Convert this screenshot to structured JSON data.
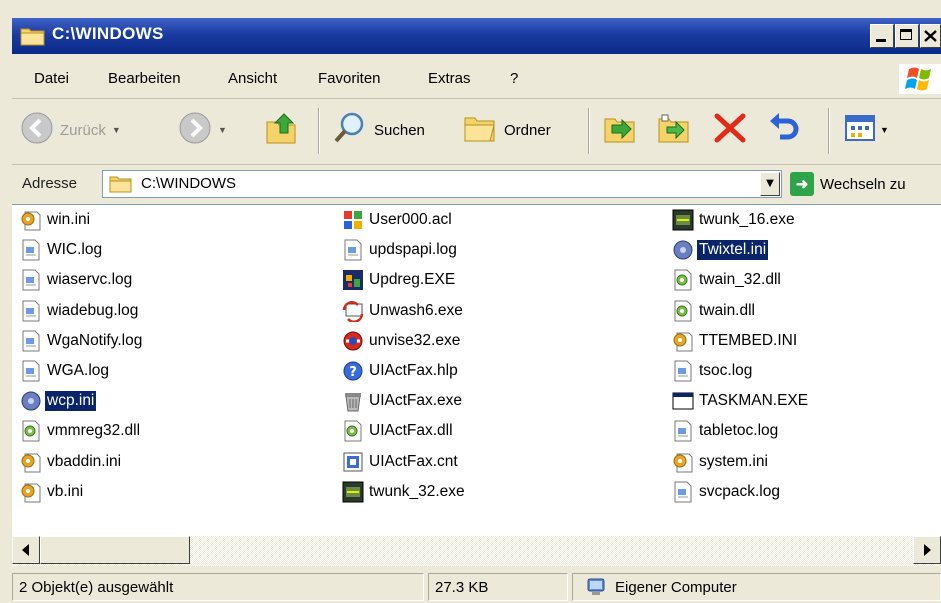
{
  "window": {
    "title": "C:\\WINDOWS"
  },
  "menu": [
    "Datei",
    "Bearbeiten",
    "Ansicht",
    "Favoriten",
    "Extras",
    "?"
  ],
  "toolbar": {
    "back_label": "Zurück",
    "search_label": "Suchen",
    "folders_label": "Ordner"
  },
  "address": {
    "label": "Adresse",
    "value": "C:\\WINDOWS",
    "go_label": "Wechseln zu"
  },
  "files": {
    "column1": [
      {
        "name": "win.ini",
        "icon": "config-file-icon",
        "selected": false
      },
      {
        "name": "WIC.log",
        "icon": "text-file-icon",
        "selected": false
      },
      {
        "name": "wiaservc.log",
        "icon": "text-file-icon",
        "selected": false
      },
      {
        "name": "wiadebug.log",
        "icon": "text-file-icon",
        "selected": false
      },
      {
        "name": "WgaNotify.log",
        "icon": "text-file-icon",
        "selected": false
      },
      {
        "name": "WGA.log",
        "icon": "text-file-icon",
        "selected": false
      },
      {
        "name": "wcp.ini",
        "icon": "unknown-config-icon",
        "selected": true
      },
      {
        "name": "vmmreg32.dll",
        "icon": "dll-file-icon",
        "selected": false
      },
      {
        "name": "vbaddin.ini",
        "icon": "config-file-icon",
        "selected": false
      },
      {
        "name": "vb.ini",
        "icon": "config-file-icon",
        "selected": false
      }
    ],
    "column2": [
      {
        "name": "User000.acl",
        "icon": "acl-file-icon",
        "selected": false
      },
      {
        "name": "updspapi.log",
        "icon": "text-file-icon",
        "selected": false
      },
      {
        "name": "Updreg.EXE",
        "icon": "update-exe-icon",
        "selected": false
      },
      {
        "name": "Unwash6.exe",
        "icon": "uninstall-exe-icon",
        "selected": false
      },
      {
        "name": "unvise32.exe",
        "icon": "unvise-exe-icon",
        "selected": false
      },
      {
        "name": "UIActFax.hlp",
        "icon": "help-file-icon",
        "selected": false
      },
      {
        "name": "UIActFax.exe",
        "icon": "fax-exe-icon",
        "selected": false
      },
      {
        "name": "UIActFax.dll",
        "icon": "dll-file-icon",
        "selected": false
      },
      {
        "name": "UIActFax.cnt",
        "icon": "help-contents-icon",
        "selected": false
      },
      {
        "name": "twunk_32.exe",
        "icon": "scanner-exe-icon",
        "selected": false
      }
    ],
    "column3": [
      {
        "name": "twunk_16.exe",
        "icon": "scanner-exe-icon",
        "selected": false
      },
      {
        "name": "Twixtel.ini",
        "icon": "unknown-config-icon",
        "selected": true
      },
      {
        "name": "twain_32.dll",
        "icon": "dll-file-icon",
        "selected": false
      },
      {
        "name": "twain.dll",
        "icon": "dll-file-icon",
        "selected": false
      },
      {
        "name": "TTEMBED.INI",
        "icon": "config-file-icon",
        "selected": false
      },
      {
        "name": "tsoc.log",
        "icon": "text-file-icon",
        "selected": false
      },
      {
        "name": "TASKMAN.EXE",
        "icon": "window-exe-icon",
        "selected": false
      },
      {
        "name": "tabletoc.log",
        "icon": "text-file-icon",
        "selected": false
      },
      {
        "name": "system.ini",
        "icon": "config-file-icon",
        "selected": false
      },
      {
        "name": "svcpack.log",
        "icon": "text-file-icon",
        "selected": false
      }
    ]
  },
  "status": {
    "selection": "2 Objekt(e) ausgewählt",
    "size": "27.3 KB",
    "location": "Eigener Computer"
  },
  "colors": {
    "titlebar": "#0a2a8a",
    "selection": "#0a246a",
    "chrome": "#ece9d8"
  }
}
